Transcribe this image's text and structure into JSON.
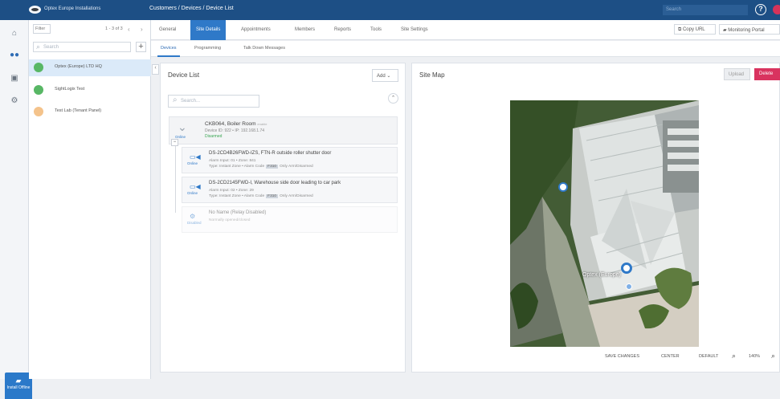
{
  "topbar": {
    "app_title": "Optex Europe Installations",
    "breadcrumb": "Customers / Devices / Device List",
    "search_placeholder": "Search",
    "help_icon": "?"
  },
  "leftnav": {
    "icons": [
      "home-icon",
      "users-icon",
      "building-icon",
      "settings-icon"
    ],
    "bottom_label": "Install Offline"
  },
  "customer_panel": {
    "filter_label": "Filter",
    "pager_text": "1 - 3 of 3",
    "search_placeholder": "Search",
    "customers": [
      {
        "name": "Optex (Europe) LTD HQ",
        "selected": true,
        "status": "online"
      },
      {
        "name": "SightLogix Test",
        "selected": false,
        "status": "online"
      },
      {
        "name": "Test Lab (Tenant Panel)",
        "selected": false,
        "status": "offline"
      }
    ]
  },
  "tabs": {
    "items": [
      "General",
      "Site Details",
      "Appointments",
      "Members",
      "Reports",
      "Tools",
      "Site Settings"
    ],
    "active": "Site Details",
    "copy_url": "Copy URL",
    "monitoring": "Monitoring Portal"
  },
  "subtabs": {
    "items": [
      "Devices",
      "Programming",
      "Talk Down Messages"
    ],
    "active": "Devices"
  },
  "device_list": {
    "title": "Device List",
    "add_label": "Add",
    "search_placeholder": "Search...",
    "controller": {
      "name": "CKB064, Boiler Room",
      "badge": "enable",
      "meta": "Device ID: 922 • IP: 192.168.1.74",
      "status_small": "Online",
      "status_state": "Disarmed"
    },
    "children": [
      {
        "name": "DS-2CD4B26FWD-IZS, FTN-R outside roller shutter door",
        "meta": "Alarm Input: 01 • Zone: 841",
        "type_line": "Type: Instant Zone • Alarm Code",
        "tag": "F310",
        "tag_text": "Only Arm/Disarmed",
        "status": "Online"
      },
      {
        "name": "DS-2CD2145FWD-I, Warehouse side door leading to car park",
        "meta": "Alarm Input: 02 • Zone: 29",
        "type_line": "Type: Instant Zone • Alarm Code",
        "tag": "F310",
        "tag_text": "Only Arm/Disarmed",
        "status": "Online"
      },
      {
        "name": "No Name (Relay Disabled)",
        "meta": "Normally opened/closed",
        "type_line": "",
        "tag": "",
        "tag_text": "",
        "status": "Disabled"
      }
    ]
  },
  "site_map": {
    "title": "Site Map",
    "upload_label": "Upload",
    "delete_label": "Delete",
    "map_label": "Optex (Europe)",
    "save_label": "SAVE CHANGES",
    "center_label": "CENTER",
    "default_label": "DEFAULT",
    "zoom_level": "140%"
  },
  "colors": {
    "brand": "#1d4f85",
    "accent": "#2f79c8",
    "danger": "#d9335f",
    "success": "#58b765"
  }
}
